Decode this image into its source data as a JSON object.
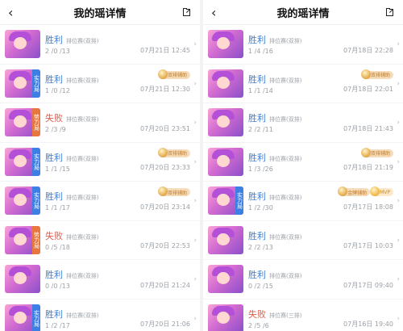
{
  "left": {
    "title": "我的瑶详情",
    "rows": [
      {
        "result": "胜利",
        "mode": "排位赛(双排)",
        "kda": "2 /0 /13",
        "time": "07月21日 12:45",
        "badge": "",
        "tag": ""
      },
      {
        "result": "胜利",
        "mode": "排位赛(双排)",
        "kda": "1 /0 /12",
        "time": "07月21日 12:30",
        "badge": "实力局",
        "tag": "双排辅助"
      },
      {
        "result": "失败",
        "mode": "排位赛(双排)",
        "kda": "2 /3 /9",
        "time": "07月20日 23:51",
        "badge": "势力局",
        "tag": ""
      },
      {
        "result": "胜利",
        "mode": "排位赛(双排)",
        "kda": "1 /1 /15",
        "time": "07月20日 23:33",
        "badge": "实力局",
        "tag": "双排辅助"
      },
      {
        "result": "胜利",
        "mode": "排位赛(双排)",
        "kda": "1 /1 /17",
        "time": "07月20日 23:14",
        "badge": "实力局",
        "tag": "双排辅助"
      },
      {
        "result": "失败",
        "mode": "排位赛(双排)",
        "kda": "0 /5 /18",
        "time": "07月20日 22:53",
        "badge": "势力局",
        "tag": ""
      },
      {
        "result": "胜利",
        "mode": "排位赛(双排)",
        "kda": "0 /0 /13",
        "time": "07月20日 21:24",
        "badge": "",
        "tag": ""
      },
      {
        "result": "胜利",
        "mode": "排位赛(双排)",
        "kda": "1 /2 /17",
        "time": "07月20日 21:06",
        "badge": "实力局",
        "tag": ""
      }
    ]
  },
  "right": {
    "title": "我的瑶详情",
    "rows": [
      {
        "result": "胜利",
        "mode": "排位赛(双排)",
        "kda": "1 /4 /16",
        "time": "07月18日 22:28",
        "badge": "",
        "tag": ""
      },
      {
        "result": "胜利",
        "mode": "排位赛(双排)",
        "kda": "1 /1 /14",
        "time": "07月18日 22:01",
        "badge": "",
        "tag": "双排辅助"
      },
      {
        "result": "胜利",
        "mode": "排位赛(双排)",
        "kda": "2 /2 /11",
        "time": "07月18日 21:43",
        "badge": "",
        "tag": ""
      },
      {
        "result": "胜利",
        "mode": "排位赛(双排)",
        "kda": "1 /3 /26",
        "time": "07月18日 21:19",
        "badge": "",
        "tag": "双排辅助"
      },
      {
        "result": "胜利",
        "mode": "排位赛(双排)",
        "kda": "1 /2 /30",
        "time": "07月17日 18:08",
        "badge": "实力局",
        "tag": "金牌辅助",
        "mvp": "MVP"
      },
      {
        "result": "胜利",
        "mode": "排位赛(双排)",
        "kda": "2 /2 /13",
        "time": "07月17日 10:03",
        "badge": "",
        "tag": ""
      },
      {
        "result": "胜利",
        "mode": "排位赛(双排)",
        "kda": "0 /2 /15",
        "time": "07月17日 09:40",
        "badge": "",
        "tag": ""
      },
      {
        "result": "失败",
        "mode": "排位赛(三排)",
        "kda": "2 /5 /6",
        "time": "07月16日 19:40",
        "badge": "",
        "tag": ""
      }
    ]
  },
  "colors": {
    "win": "#3f7fd8",
    "loss": "#e05b4a",
    "bg": "#f2f3f5"
  }
}
